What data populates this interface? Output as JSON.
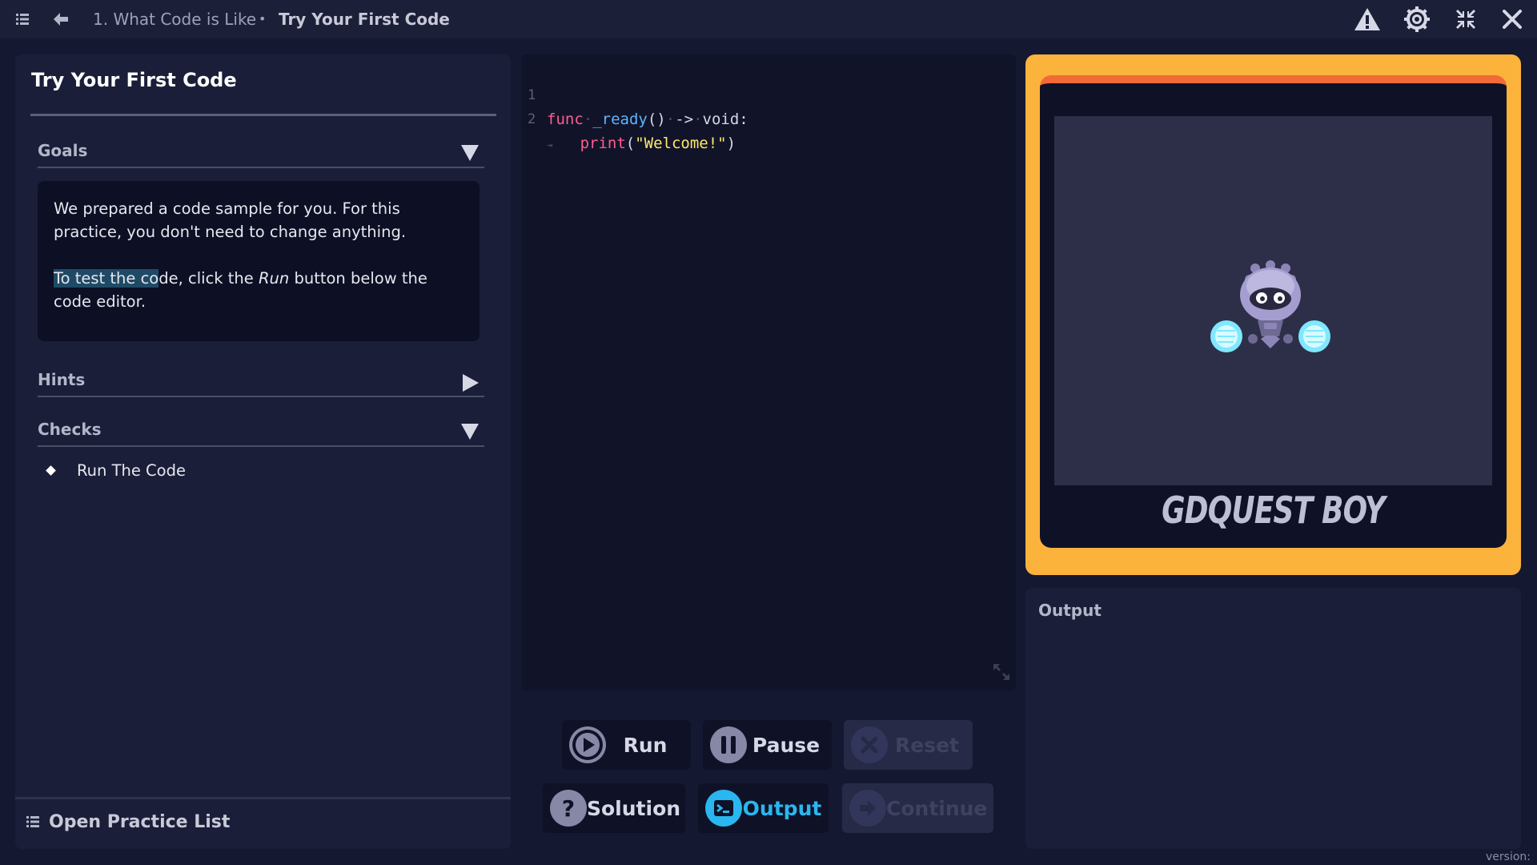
{
  "topbar": {
    "parent_crumb": "1. What Code is Like",
    "separator": "•",
    "current_crumb": "Try Your First Code",
    "icons": [
      "menu-icon",
      "back-arrow-icon",
      "warning-icon",
      "gear-icon",
      "fullscreen-icon",
      "close-icon"
    ]
  },
  "left_panel": {
    "title": "Try Your First Code",
    "goals": {
      "label": "Goals",
      "paragraph1": "We prepared a code sample for you. For this practice, you don't need to change anything.",
      "p2_highlight": "To test the co",
      "p2_a": "de, click the ",
      "p2_italic": "Run",
      "p2_b": " button below the code editor."
    },
    "hints": {
      "label": "Hints"
    },
    "checks": {
      "label": "Checks",
      "items": [
        "Run The Code"
      ]
    },
    "footer_label": "Open Practice List"
  },
  "editor": {
    "line_numbers": [
      "1",
      "2"
    ],
    "line1": {
      "kw": "func",
      "name": "_ready",
      "parens": "()",
      "arrow": "->",
      "type": "void:"
    },
    "line2": {
      "fn": "print",
      "open": "(",
      "str": "\"Welcome!\"",
      "close": ")"
    }
  },
  "buttons": {
    "run": "Run",
    "pause": "Pause",
    "reset": "Reset",
    "solution": "Solution",
    "output": "Output",
    "continue": "Continue"
  },
  "game": {
    "brand": "GDQUEST BOY"
  },
  "output_panel": {
    "title": "Output"
  },
  "footer": {
    "version_label": "version:"
  },
  "colors": {
    "background": "#141831",
    "panel": "#1b1e38",
    "accent_frame": "#fbb33b",
    "keyword": "#ff5d8f",
    "function": "#5fb4ff",
    "string": "#ffe86b",
    "active_button": "#2ab6ee"
  }
}
